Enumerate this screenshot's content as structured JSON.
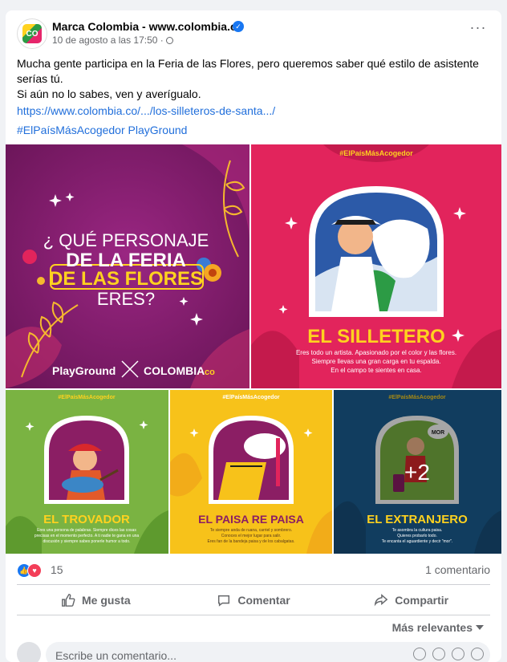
{
  "post": {
    "page_name": "Marca Colombia - www.colombia.co",
    "avatar_text": "CO",
    "timestamp": "10 de agosto a las 17:50 ·",
    "text_line1": "Mucha gente participa en la Feria de las Flores, pero queremos saber qué estilo de asistente serías tú.",
    "text_line2": "Si aún no lo sabes, ven y averígualo.",
    "link": "https://www.colombia.co/.../los-silleteros-de-santa.../",
    "hashtag": "#ElPaísMásAcogedor PlayGround"
  },
  "images": {
    "main": {
      "line1": "¿ QUÉ PERSONAJE",
      "line2": "DE LA FERIA",
      "line3": "DE LAS FLORES",
      "line4": "ERES?",
      "brand_left": "PlayGround",
      "brand_right": "COLOMBIA",
      "brand_co": "co"
    },
    "silletero": {
      "tag": "#ElPaísMásAcogedor",
      "title": "EL SILLETERO",
      "desc1": "Eres todo un artista. Apasionado por el color y las flores.",
      "desc2": "Siempre llevas una gran carga en tu espalda.",
      "desc3": "En el campo te sientes en casa."
    },
    "trovador": {
      "tag": "#ElPaísMásAcogedor",
      "title": "EL TROVADOR",
      "desc1": "Eres una persona de palabras. Siempre dices las cosas",
      "desc2": "precisas en el momento perfecto. A ti nadie te gana en una",
      "desc3": "discusión y siempre sabes ponerle humor a todo."
    },
    "paisa": {
      "tag": "#ElPaísMásAcogedor",
      "title": "EL PAISA RE PAISA",
      "desc1": "Te siempre anda de ruana, carriel y sombrero.",
      "desc2": "Conoces el mejor lugar para salir.",
      "desc3": "Eres fan de la bandeja paisa y de los cabalgatas."
    },
    "extranjero": {
      "tag": "#ElPaísMásAcogedor",
      "title": "EL EXTRANJERO",
      "badge": "MOR",
      "desc1": "Te asombra la cultura paisa.",
      "desc2": "Quieres probarlo todo.",
      "desc3": "Te encanta el aguardiente y decir \"mor\".",
      "more_count": "+2"
    }
  },
  "reactions": {
    "count": "15",
    "comments": "1 comentario"
  },
  "actions": {
    "like": "Me gusta",
    "comment": "Comentar",
    "share": "Compartir"
  },
  "comments": {
    "sort_label": "Más relevantes",
    "placeholder": "Escribe un comentario..."
  },
  "colors": {
    "link": "#216fdb",
    "brand_blue": "#1877f2",
    "purple": "#7c1a66",
    "pink": "#e2245c",
    "green": "#7ab342",
    "yellow": "#f7c21a",
    "blue": "#1b5f93",
    "title_yellow": "#ffd21f"
  }
}
